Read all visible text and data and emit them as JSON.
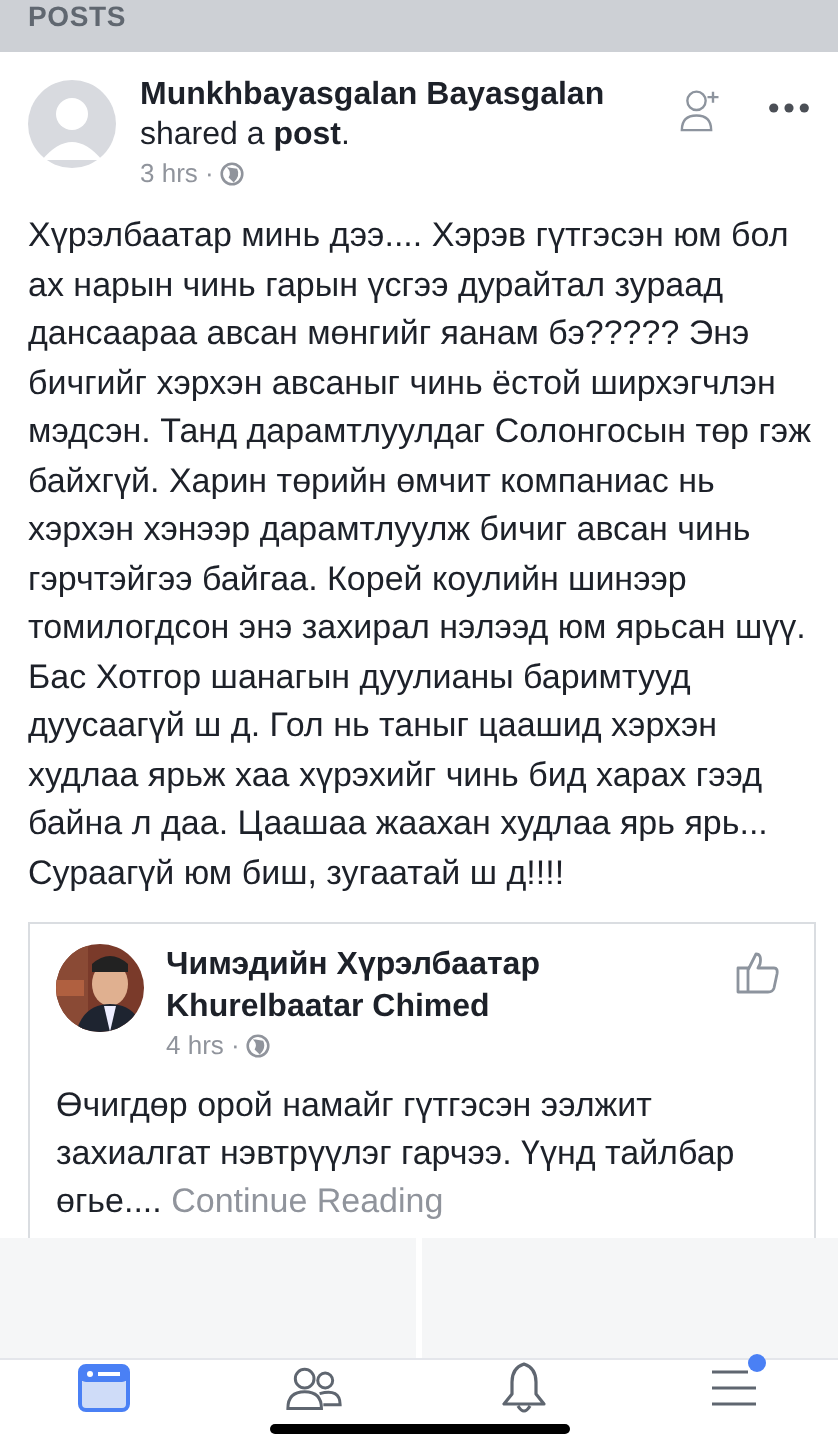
{
  "section_header": "POSTS",
  "post": {
    "author": "Munkhbayasgalan Bayasgalan",
    "action": "shared a **post**.",
    "time": "3 hrs ·",
    "body": "Хүрэлбаатар минь дээ.... Хэрэв гүтгэсэн юм бол ах нарын чинь гарын үсгээ дурайтал зураад дансаараа авсан мөнгийг яанам бэ????? Энэ бичгийг хэрхэн авсаныг чинь ёстой ширхэгчлэн мэдсэн. Танд дарамтлуулдаг Солонгосын төр гэж байхгүй. Харин төрийн өмчит компаниас нь хэрхэн хэнээр дарамтлуулж бичиг авсан чинь гэрчтэйгээ байгаа. Корей коулийн шинээр томилогдсон  энэ захирал нэлээд юм ярьсан шүү.  Бас Хотгор шанагын дуулианы баримтууд дуусаагүй ш д. Гол нь таныг цаашид хэрхэн худлаа ярьж хаа хүрэхийг чинь бид харах гээд байна л даа. Цаашаа жаахан худлаа ярь ярь... Сураагүй юм биш, зугаатай ш д!!!!",
    "shared": {
      "author": "Чимэдийн Хүрэлбаатар Khurelbaatar Chimed",
      "time": "4 hrs ·",
      "body": "Өчигдөр орой намайг гүтгэсэн ээлжит захиалгат нэвтрүүлэг гарчээ. Үүнд тайлбар өгье....",
      "link": "Continue Reading"
    }
  },
  "tab_bar": [
    {
      "kind": "feed",
      "selected": true
    },
    {
      "kind": "friends",
      "selected": false
    },
    {
      "kind": "bell",
      "selected": false
    },
    {
      "kind": "menu",
      "selected": false,
      "color": "#4a80f5"
    }
  ]
}
